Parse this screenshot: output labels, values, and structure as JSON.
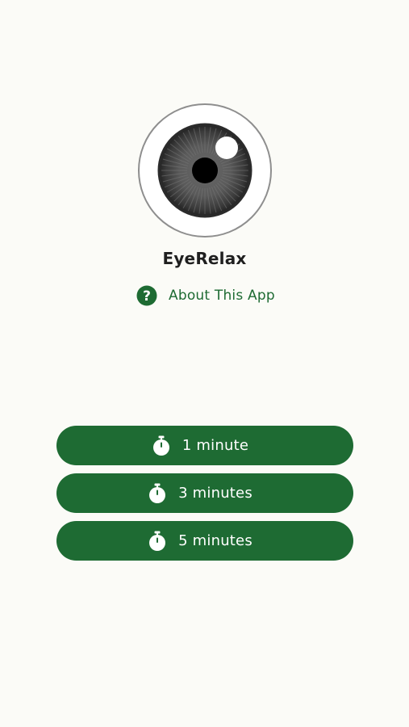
{
  "app": {
    "title": "EyeRelax",
    "logo_icon": "eye-icon"
  },
  "about": {
    "icon": "help-circle-icon",
    "label": "About This App"
  },
  "timers": [
    {
      "label": "1 minute",
      "icon": "stopwatch-icon"
    },
    {
      "label": "3 minutes",
      "icon": "stopwatch-icon"
    },
    {
      "label": "5 minutes",
      "icon": "stopwatch-icon"
    }
  ],
  "colors": {
    "background": "#FBFBF7",
    "accent": "#1E6B33",
    "title_text": "#1F1F1F",
    "button_text": "#FFFFFF"
  }
}
